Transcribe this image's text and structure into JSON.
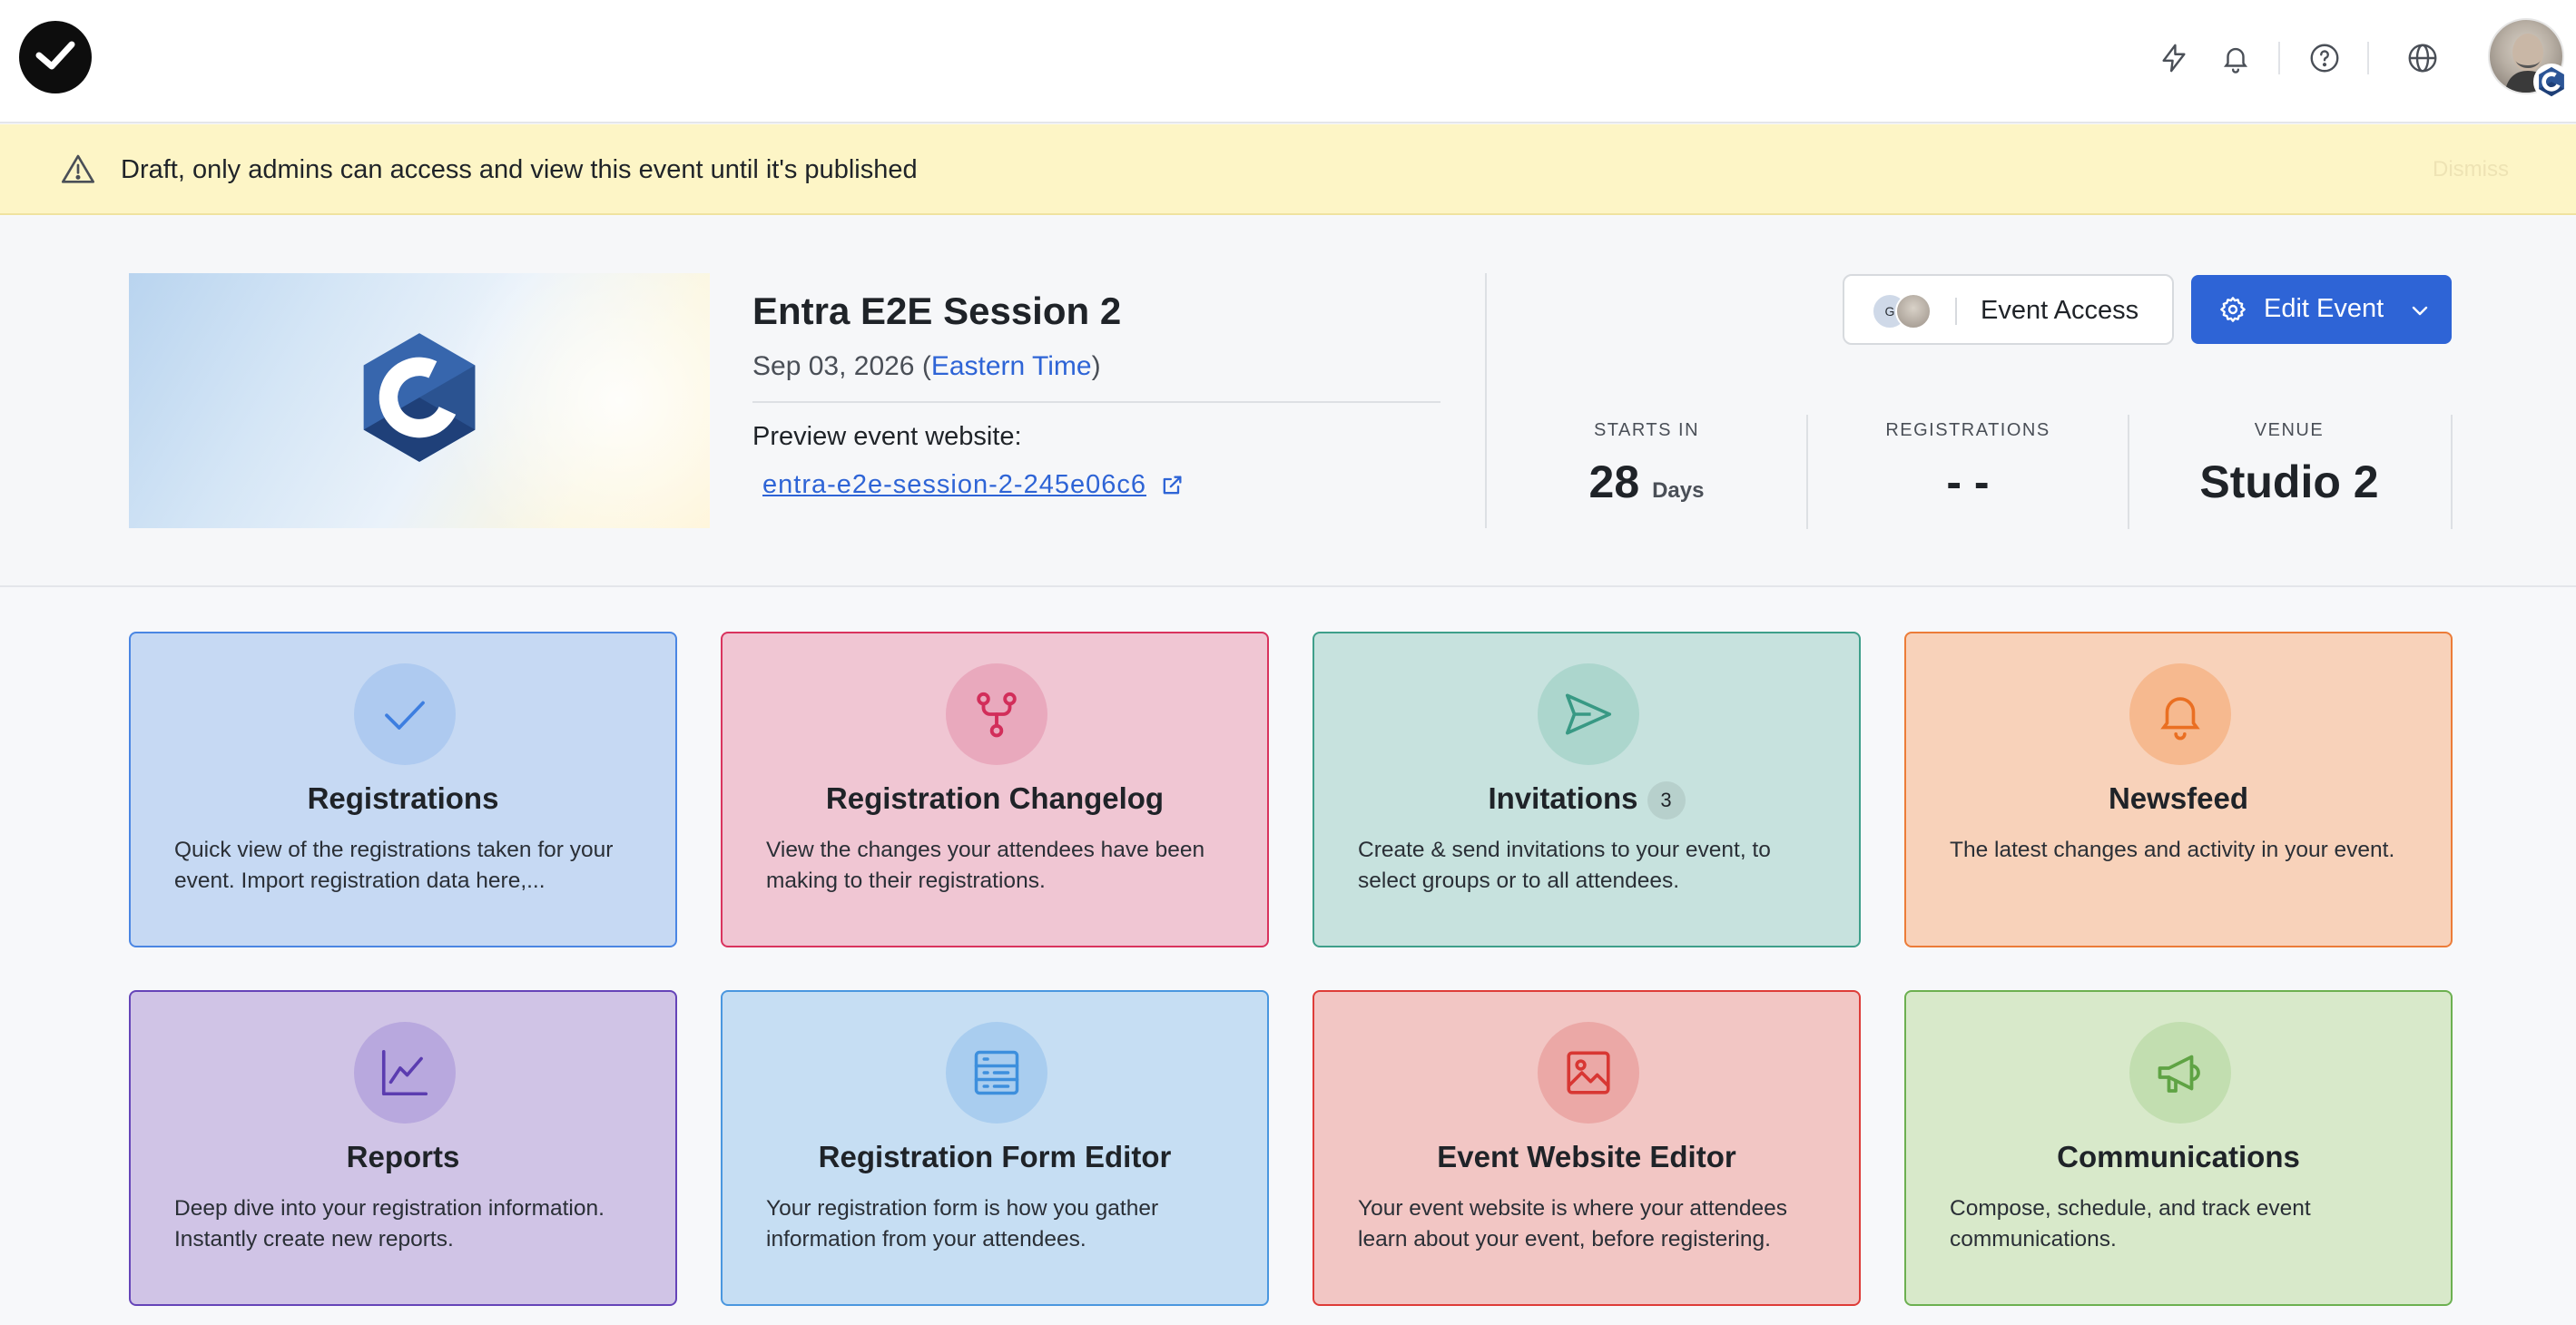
{
  "banner": {
    "text": "Draft, only admins can access and view this event until it's published",
    "dismiss": "Dismiss"
  },
  "event": {
    "title": "Entra E2E Session 2",
    "date": "Sep 03, 2026",
    "timezone": "Eastern Time",
    "preview_label": "Preview event website:",
    "preview_link": "entra-e2e-session-2-245e06c6"
  },
  "actions": {
    "event_access": "Event Access",
    "access_avatar_initials": "G",
    "edit_event": "Edit Event"
  },
  "stats": [
    {
      "label": "STARTS IN",
      "value": "28",
      "unit": "Days"
    },
    {
      "label": "REGISTRATIONS",
      "value": "- -",
      "unit": ""
    },
    {
      "label": "VENUE",
      "value": "Studio 2",
      "unit": ""
    }
  ],
  "cards": [
    {
      "title": "Registrations",
      "count": "",
      "icon": "check-icon",
      "desc": "Quick view of the registrations taken for your event. Import registration data here,..."
    },
    {
      "title": "Registration Changelog",
      "count": "",
      "icon": "branch-icon",
      "desc": "View the changes your attendees have been making to their registrations."
    },
    {
      "title": "Invitations",
      "count": "3",
      "icon": "send-icon",
      "desc": "Create & send invitations to your event, to select groups or to all attendees."
    },
    {
      "title": "Newsfeed",
      "count": "",
      "icon": "bell-icon",
      "desc": "The latest changes and activity in your event."
    },
    {
      "title": "Reports",
      "count": "",
      "icon": "chart-line-icon",
      "desc": "Deep dive into your registration information. Instantly create new reports."
    },
    {
      "title": "Registration Form Editor",
      "count": "",
      "icon": "form-icon",
      "desc": "Your registration form is how you gather information from your attendees."
    },
    {
      "title": "Event Website Editor",
      "count": "",
      "icon": "image-icon",
      "desc": "Your event website is where your attendees learn about your event, before registering."
    },
    {
      "title": "Communications",
      "count": "",
      "icon": "megaphone-icon",
      "desc": "Compose, schedule, and track event communications."
    }
  ],
  "colors": {
    "primary": "#2e64d6",
    "banner_bg": "#fdf5c6",
    "registrations": "#4a86e3",
    "changelog": "#d9335e",
    "invitations": "#3e9f8a",
    "newsfeed": "#ec7c38",
    "reports": "#6544b8",
    "form_editor": "#4a97df",
    "website_editor": "#de3c38",
    "communications": "#6cb050"
  }
}
